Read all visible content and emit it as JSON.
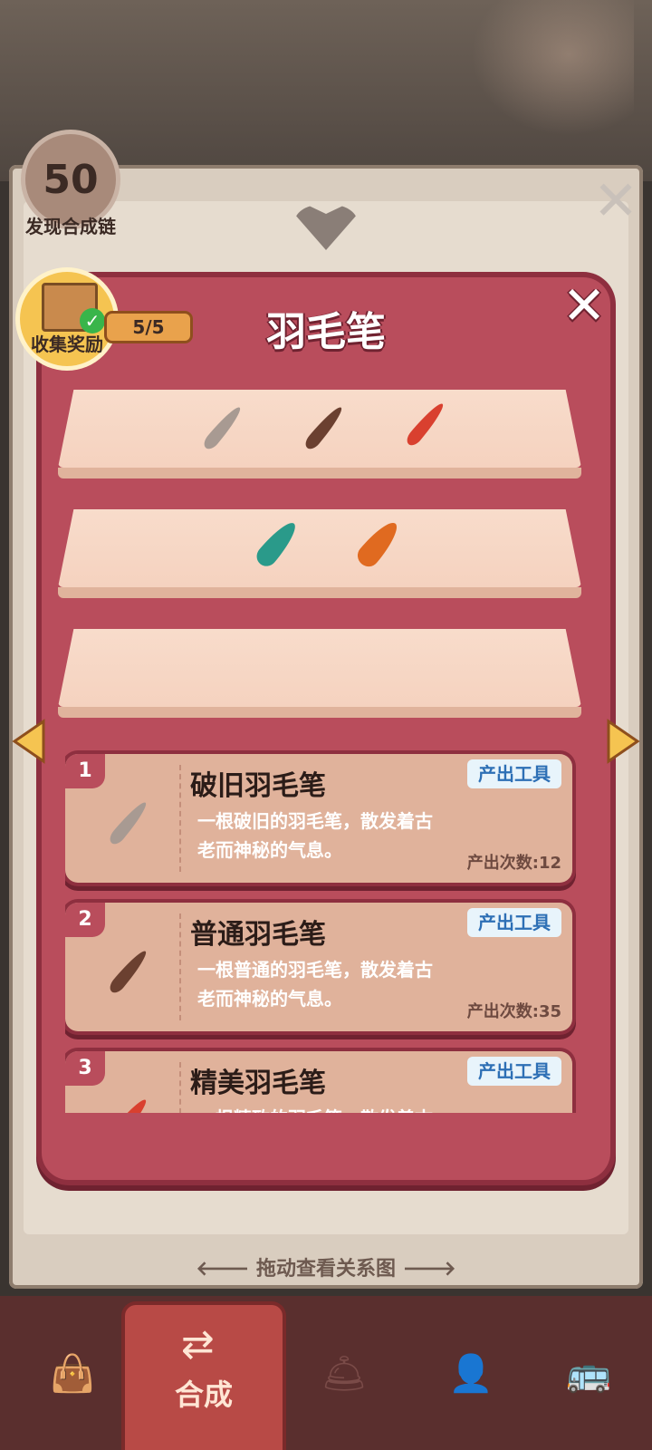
{
  "discovery": {
    "count": "50",
    "label": "发现合成链"
  },
  "dialog": {
    "title": "羽毛笔",
    "progress": "5/5",
    "reward_label": "收集奖励",
    "reward_claimed": true,
    "reward_box_text": "奖励"
  },
  "shelves": [
    {
      "items": [
        {
          "icon": "worn-quill-icon",
          "color": "#a89a92"
        },
        {
          "icon": "brown-quill-icon",
          "color": "#6b4030"
        },
        {
          "icon": "red-quill-icon",
          "color": "#d9402f"
        }
      ]
    },
    {
      "items": [
        {
          "icon": "peacock-quill-icon",
          "color": "#2a9a8a"
        },
        {
          "icon": "phoenix-quill-icon",
          "color": "#e06a20"
        }
      ]
    },
    {
      "items": []
    }
  ],
  "cards": [
    {
      "index": "1",
      "name": "破旧羽毛笔",
      "desc_line1": "一根破旧的羽毛笔，散发着古",
      "desc_line2": "老而神秘的气息。",
      "tag": "产出工具",
      "count": "产出次数:12",
      "icon": "worn-quill-icon",
      "color": "#a89a92"
    },
    {
      "index": "2",
      "name": "普通羽毛笔",
      "desc_line1": "一根普通的羽毛笔，散发着古",
      "desc_line2": "老而神秘的气息。",
      "tag": "产出工具",
      "count": "产出次数:35",
      "icon": "brown-quill-icon",
      "color": "#6b4030"
    },
    {
      "index": "3",
      "name": "精美羽毛笔",
      "desc_line1": "一根精致的羽毛笔，散发着古",
      "desc_line2": "",
      "tag": "产出工具",
      "count": "",
      "icon": "red-quill-icon",
      "color": "#d9402f"
    }
  ],
  "drag_hint": "拖动查看关系图",
  "tabs": [
    {
      "name": "tab-bag",
      "icon": "bag-icon",
      "label": ""
    },
    {
      "name": "tab-merge",
      "icon": "merge-icon",
      "label": "合成",
      "active": true
    },
    {
      "name": "tab-service",
      "icon": "service-bell-icon",
      "label": ""
    },
    {
      "name": "tab-staff",
      "icon": "person-icon",
      "label": ""
    },
    {
      "name": "tab-bus",
      "icon": "bus-icon",
      "label": ""
    }
  ]
}
